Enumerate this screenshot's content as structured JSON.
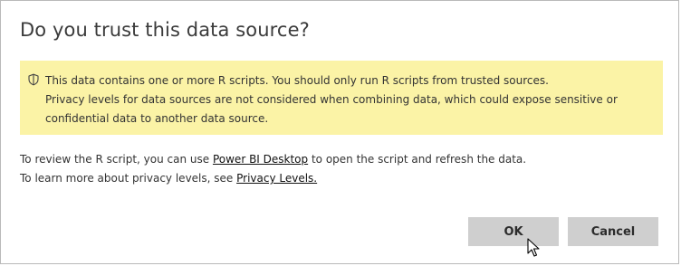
{
  "dialog": {
    "title": "Do you trust this data source?"
  },
  "warning": {
    "icon": "shield-icon",
    "background": "#fbf3a6",
    "line1": "This data contains one or more R scripts. You should only run R scripts from trusted sources.",
    "line2": "Privacy levels for data sources are not considered when combining data, which could expose sensitive or",
    "line3": "confidential data to another data source."
  },
  "info": {
    "review_prefix": "To review the R script, you can use ",
    "review_link": "Power BI Desktop",
    "review_suffix": " to open the script and refresh the data.",
    "privacy_prefix": "To learn more about privacy levels, see ",
    "privacy_link": "Privacy Levels."
  },
  "buttons": {
    "ok_label": "OK",
    "cancel_label": "Cancel"
  }
}
